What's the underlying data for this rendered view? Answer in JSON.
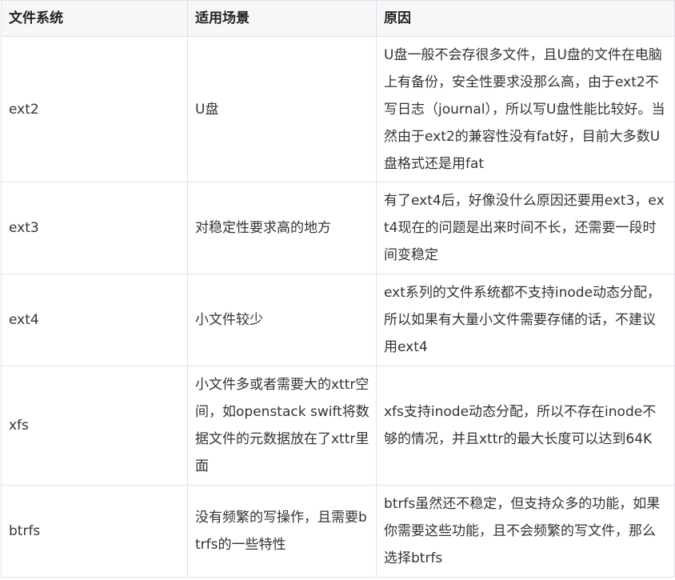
{
  "table": {
    "headers": [
      "文件系统",
      "适用场景",
      "原因"
    ],
    "rows": [
      {
        "fs": "ext2",
        "scenario": "U盘",
        "reason": "U盘一般不会存很多文件，且U盘的文件在电脑上有备份，安全性要求没那么高，由于ext2不写日志（journal），所以写U盘性能比较好。当然由于ext2的兼容性没有fat好，目前大多数U盘格式还是用fat"
      },
      {
        "fs": "ext3",
        "scenario": "对稳定性要求高的地方",
        "reason": "有了ext4后，好像没什么原因还要用ext3，ext4现在的问题是出来时间不长，还需要一段时间变稳定"
      },
      {
        "fs": "ext4",
        "scenario": "小文件较少",
        "reason": "ext系列的文件系统都不支持inode动态分配，所以如果有大量小文件需要存储的话，不建议用ext4"
      },
      {
        "fs": "xfs",
        "scenario": "小文件多或者需要大的xttr空间，如openstack swift将数据文件的元数据放在了xttr里面",
        "reason": "xfs支持inode动态分配，所以不存在inode不够的情况，并且xttr的最大长度可以达到64K"
      },
      {
        "fs": "btrfs",
        "scenario": "没有频繁的写操作，且需要btrfs的一些特性",
        "reason": "btrfs虽然还不稳定，但支持众多的功能，如果你需要这些功能，且不会频繁的写文件，那么选择btrfs"
      }
    ]
  }
}
